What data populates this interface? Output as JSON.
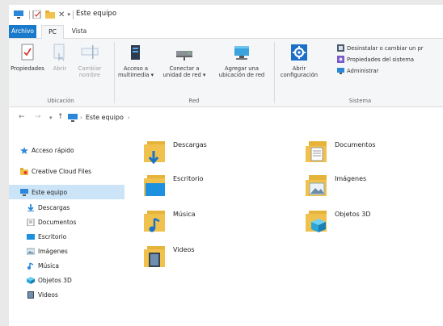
{
  "window": {
    "title": "Este equipo"
  },
  "tabs": [
    {
      "label": "Archivo"
    },
    {
      "label": "PC"
    },
    {
      "label": "Vista"
    }
  ],
  "ribbon": {
    "ubicacion": {
      "label": "Ubicación",
      "buttons": [
        {
          "line1": "Propiedades",
          "line2": ""
        },
        {
          "line1": "Abrir",
          "line2": ""
        },
        {
          "line1": "Cambiar",
          "line2": "nombre"
        }
      ]
    },
    "red": {
      "label": "Red",
      "buttons": [
        {
          "line1": "Acceso a",
          "line2": "multimedia ▾"
        },
        {
          "line1": "Conectar a",
          "line2": "unidad de red ▾"
        },
        {
          "line1": "Agregar una",
          "line2": "ubicación de red"
        }
      ]
    },
    "sistema": {
      "label": "Sistema",
      "abrir": {
        "line1": "Abrir",
        "line2": "configuración"
      },
      "items": [
        {
          "label": "Desinstalar o cambiar un pr"
        },
        {
          "label": "Propiedades del sistema"
        },
        {
          "label": "Administrar"
        }
      ]
    }
  },
  "address": {
    "path": "Este equipo",
    "back": "←",
    "forward": "→",
    "recent": "▾",
    "up": "↑"
  },
  "nav": {
    "quick_access": "Acceso rápido",
    "creative_cloud": "Creative Cloud Files",
    "this_pc": "Este equipo",
    "children": [
      {
        "label": "Descargas",
        "icon": "downloads-icon"
      },
      {
        "label": "Documentos",
        "icon": "documents-icon"
      },
      {
        "label": "Escritorio",
        "icon": "desktop-icon"
      },
      {
        "label": "Imágenes",
        "icon": "pictures-icon"
      },
      {
        "label": "Música",
        "icon": "music-icon"
      },
      {
        "label": "Objetos 3D",
        "icon": "3d-objects-icon"
      },
      {
        "label": "Videos",
        "icon": "videos-icon"
      }
    ]
  },
  "folders": [
    {
      "label": "Descargas",
      "icon": "downloads-folder-icon"
    },
    {
      "label": "Documentos",
      "icon": "documents-folder-icon"
    },
    {
      "label": "Escritorio",
      "icon": "desktop-folder-icon"
    },
    {
      "label": "Imágenes",
      "icon": "pictures-folder-icon"
    },
    {
      "label": "Música",
      "icon": "music-folder-icon"
    },
    {
      "label": "Objetos 3D",
      "icon": "3d-objects-folder-icon"
    },
    {
      "label": "Videos",
      "icon": "videos-folder-icon"
    }
  ],
  "colors": {
    "accent": "#1979ca",
    "selection": "#cce4f7",
    "folder": "#f0c24d"
  }
}
